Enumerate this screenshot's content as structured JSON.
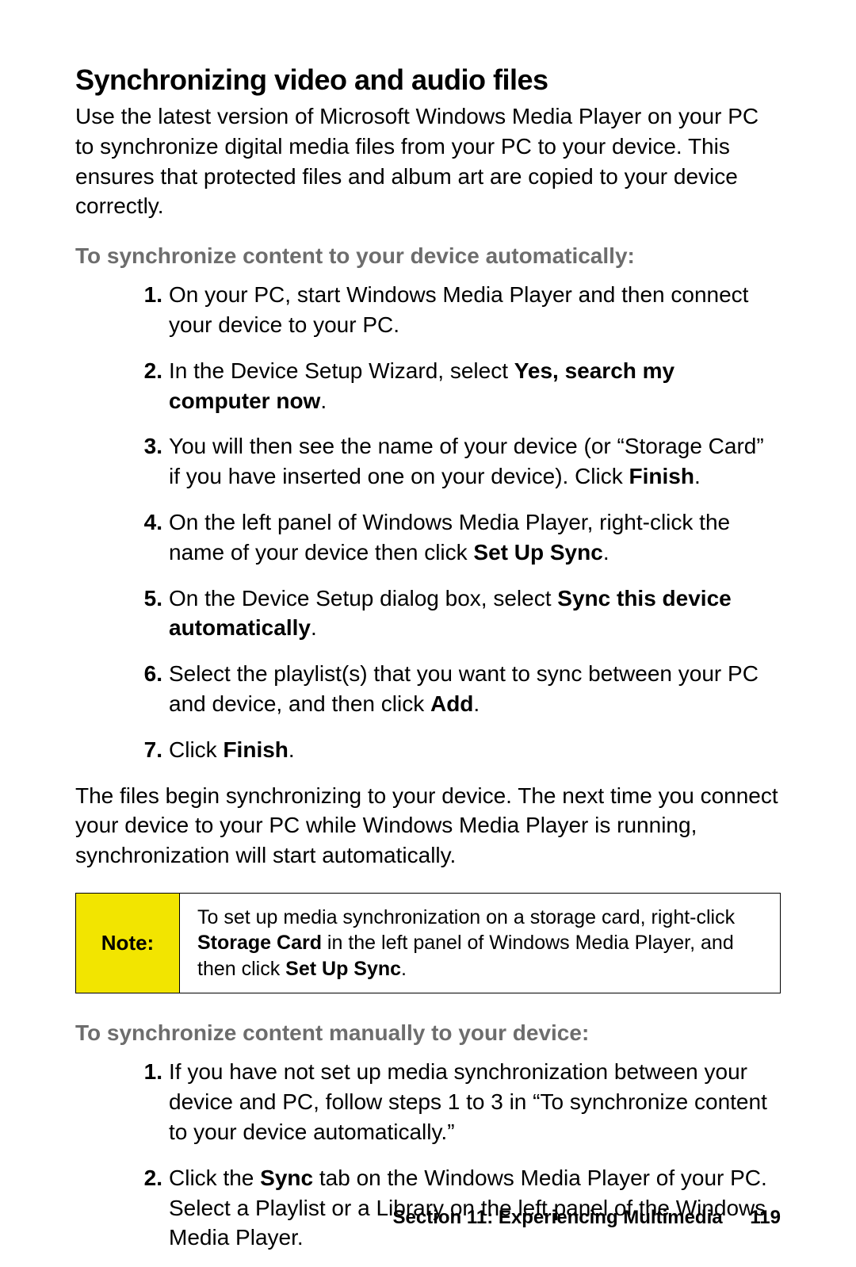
{
  "title": "Synchronizing video and audio files",
  "intro": "Use the latest version of Microsoft Windows Media Player on your PC to synchronize digital media files from your PC to your device. This ensures that protected files and album art are copied to your device correctly.",
  "subhead_auto": "To synchronize content to your device automatically:",
  "steps_auto": [
    {
      "n": "1.",
      "html": "On your PC, start Windows Media Player and then connect your device to your PC."
    },
    {
      "n": "2.",
      "html": "In the Device Setup Wizard, select <b>Yes, search my computer now</b>."
    },
    {
      "n": "3.",
      "html": "You will then see the name of your device (or “Storage Card” if you have inserted one on your device). Click <b>Finish</b>."
    },
    {
      "n": "4.",
      "html": "On the left panel of Windows Media Player, right-click the name of your device then click <b>Set Up Sync</b>."
    },
    {
      "n": "5.",
      "html": "On the Device Setup dialog box, select <b>Sync this device automatically</b>."
    },
    {
      "n": "6.",
      "html": "Select the playlist(s) that you want to sync between your PC and device, and then click <b>Add</b>."
    },
    {
      "n": "7.",
      "html": "Click <b>Finish</b>."
    }
  ],
  "outro": "The files begin synchronizing to your device. The next time you connect your device to your PC while Windows Media Player is running, synchronization will start automatically.",
  "note_label": "Note:",
  "note_body": "To set up media synchronization on a storage card, right-click <b>Storage Card</b> in the left panel of Windows Media Player, and then click <b>Set Up Sync</b>.",
  "subhead_manual": "To synchronize content manually to your device:",
  "steps_manual": [
    {
      "n": "1.",
      "html": "If you have not set up media synchronization between your device and PC, follow steps 1 to 3 in “To synchronize content to your device automatically.”"
    },
    {
      "n": "2.",
      "html": "Click the <b>Sync</b> tab on the Windows Media Player of your PC. Select a Playlist or a Library on the left panel of the Windows Media Player."
    }
  ],
  "footer_section": "Section 11: Experiencing Multimedia",
  "footer_page": "119"
}
